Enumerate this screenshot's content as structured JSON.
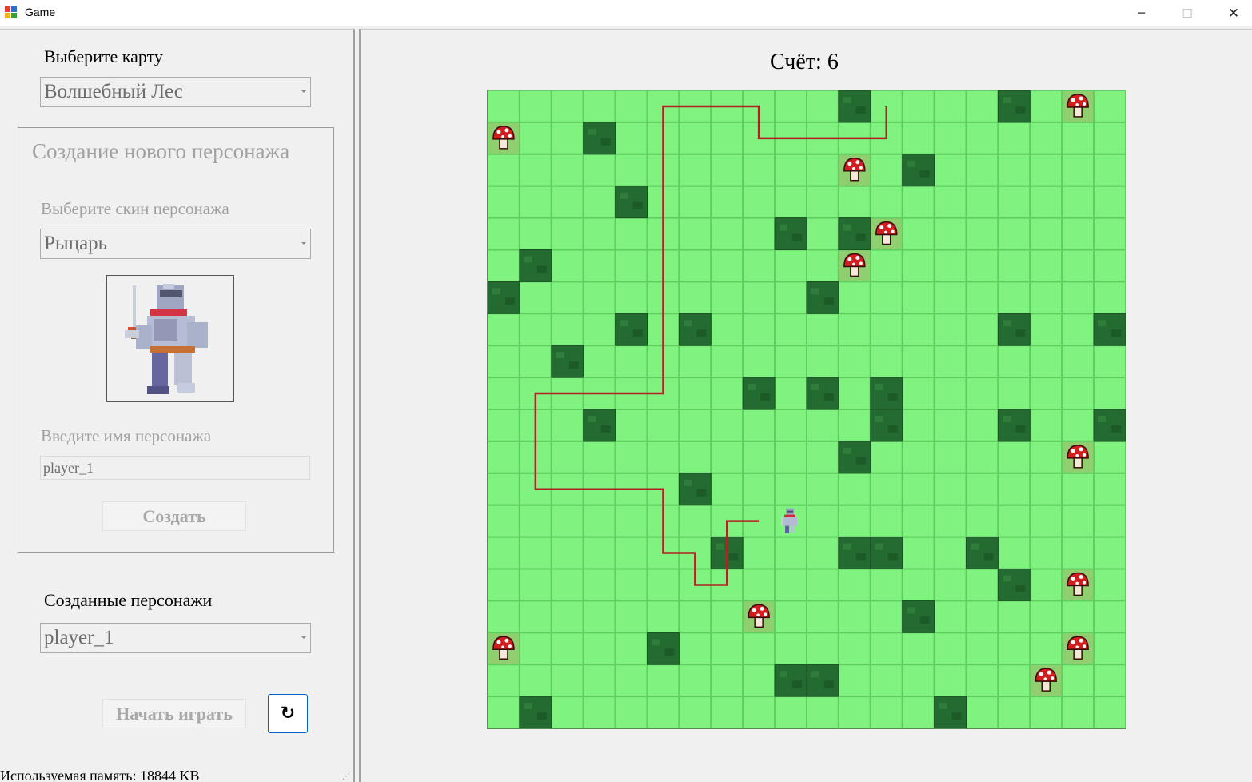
{
  "window": {
    "title": "Game",
    "icon": "window-app-icon",
    "controls": {
      "minimize": "─",
      "maximize": "☐",
      "close": "✕"
    }
  },
  "map_select": {
    "label": "Выберите карту",
    "value": "Волшебный Лес"
  },
  "create_group": {
    "title": "Создание нового персонажа",
    "skin_label": "Выберите скин персонажа",
    "skin_value": "Рыцарь",
    "skin_preview_icon": "knight-sprite-icon",
    "name_label": "Введите имя персонажа",
    "name_value": "player_1",
    "create_button": "Создать"
  },
  "characters": {
    "label": "Созданные персонажи",
    "value": "player_1"
  },
  "start_button": "Начать играть",
  "refresh_button": "↻",
  "status_bar": "Используемая память: 18844 KB",
  "score_text": "Счёт: 6",
  "board": {
    "cols": 20,
    "rows": 20,
    "colors": {
      "grass": "#7ff27f",
      "grid": "#5fcd5f",
      "bush": "#236b30",
      "mushroom_tile": "#8fcf70",
      "path": "#b22222"
    },
    "bushes": [
      [
        11,
        0
      ],
      [
        16,
        0
      ],
      [
        3,
        1
      ],
      [
        13,
        2
      ],
      [
        4,
        3
      ],
      [
        9,
        4
      ],
      [
        11,
        4
      ],
      [
        1,
        5
      ],
      [
        0,
        6
      ],
      [
        10,
        6
      ],
      [
        4,
        7
      ],
      [
        6,
        7
      ],
      [
        16,
        7
      ],
      [
        19,
        7
      ],
      [
        2,
        8
      ],
      [
        8,
        9
      ],
      [
        10,
        9
      ],
      [
        12,
        9
      ],
      [
        3,
        10
      ],
      [
        12,
        10
      ],
      [
        16,
        10
      ],
      [
        19,
        10
      ],
      [
        11,
        11
      ],
      [
        6,
        12
      ],
      [
        7,
        14
      ],
      [
        11,
        14
      ],
      [
        12,
        14
      ],
      [
        15,
        14
      ],
      [
        16,
        15
      ],
      [
        13,
        16
      ],
      [
        5,
        17
      ],
      [
        9,
        18
      ],
      [
        10,
        18
      ],
      [
        1,
        19
      ],
      [
        14,
        19
      ]
    ],
    "mushrooms": [
      [
        18,
        0
      ],
      [
        0,
        1
      ],
      [
        11,
        2
      ],
      [
        12,
        4
      ],
      [
        11,
        5
      ],
      [
        18,
        11
      ],
      [
        18,
        15
      ],
      [
        8,
        16
      ],
      [
        0,
        17
      ],
      [
        18,
        17
      ],
      [
        17,
        18
      ]
    ],
    "player": [
      9,
      13
    ],
    "path": [
      [
        8.5,
        13.5
      ],
      [
        7.5,
        13.5
      ],
      [
        7.5,
        15.5
      ],
      [
        6.5,
        15.5
      ],
      [
        6.5,
        14.5
      ],
      [
        5.5,
        14.5
      ],
      [
        5.5,
        12.5
      ],
      [
        1.5,
        12.5
      ],
      [
        1.5,
        9.5
      ],
      [
        5.5,
        9.5
      ],
      [
        5.5,
        0.5
      ],
      [
        8.5,
        0.5
      ],
      [
        8.5,
        1.5
      ],
      [
        12.5,
        1.5
      ],
      [
        12.5,
        0.5
      ]
    ]
  }
}
